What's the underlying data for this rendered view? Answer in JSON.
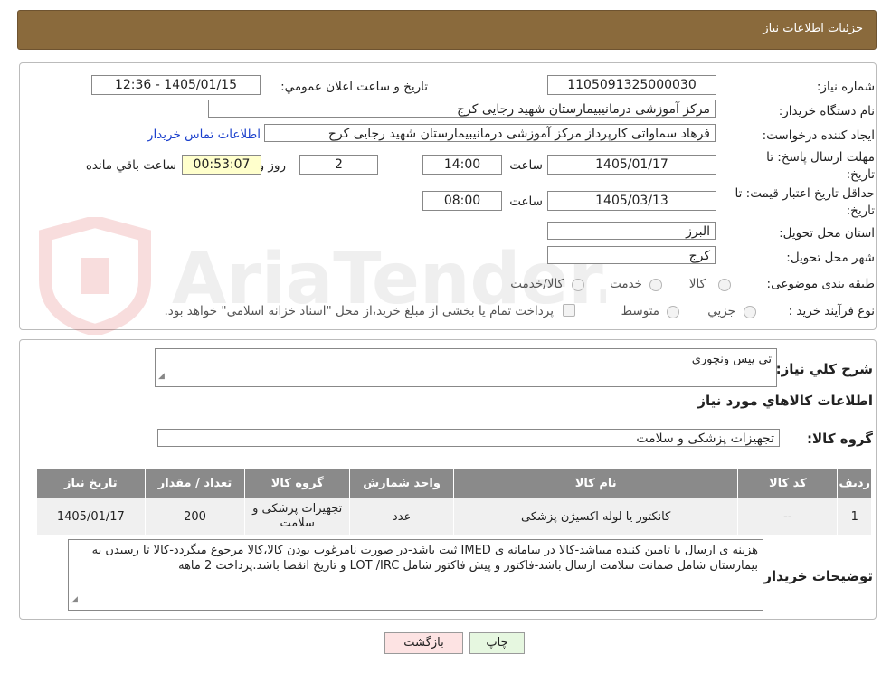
{
  "header": {
    "title": "جزئيات اطلاعات نياز"
  },
  "watermark": {
    "text": "AriaTender.neT"
  },
  "form": {
    "need_number": {
      "label": "شماره نياز:",
      "value": "1105091325000030"
    },
    "announce": {
      "label": "تاريخ و ساعت اعلان عمومي:",
      "value": "1405/01/15 - 12:36"
    },
    "buyer_org": {
      "label": "نام دستگاه خريدار:",
      "value": "مرکز آموزشی درمانیبیمارستان شهید رجایی کرج"
    },
    "requester": {
      "label": "ايجاد کننده درخواست:",
      "value": "فرهاد سماواتی کارپرداز مرکز آموزشی درمانیبیمارستان شهید رجایی کرج",
      "contact_link": "اطلاعات تماس خريدار"
    },
    "reply_deadline": {
      "label": "مهلت ارسال پاسخ: تا تاريخ:",
      "date": "1405/01/17",
      "time_label": "ساعت",
      "time": "14:00",
      "days": "2",
      "days_label": "روز و",
      "remaining": "00:53:07",
      "remaining_label": "ساعت باقي مانده"
    },
    "price_validity": {
      "label": "حداقل تاريخ اعتبار قيمت: تا تاريخ:",
      "date": "1405/03/13",
      "time_label": "ساعت",
      "time": "08:00"
    },
    "province": {
      "label": "استان محل تحويل:",
      "value": "البرز"
    },
    "city": {
      "label": "شهر محل تحويل:",
      "value": "کرج"
    },
    "category": {
      "label": "طبقه بندی موضوعی:",
      "options": [
        "کالا",
        "خدمت",
        "کالا/خدمت"
      ]
    },
    "process": {
      "label": "نوع فرآيند خريد :",
      "options": [
        "جزيي",
        "متوسط"
      ],
      "note": "پرداخت تمام یا بخشی از مبلغ خرید،از محل \"اسناد خزانه اسلامی\" خواهد بود."
    }
  },
  "summary": {
    "label": "شرح کلي نياز:",
    "value": "تی پیس ونچوری",
    "items_title": "اطلاعات کالاهاي مورد نياز",
    "group_label": "گروه کالا:",
    "group_value": "تجهیزات پزشکی و سلامت"
  },
  "table": {
    "headers": [
      "رديف",
      "کد کالا",
      "نام کالا",
      "واحد شمارش",
      "گروه کالا",
      "تعداد / مقدار",
      "تاريخ نياز"
    ],
    "rows": [
      [
        "1",
        "--",
        "کانکتور یا لوله اکسیژن پزشکی",
        "عدد",
        "تجهیزات پزشکی و سلامت",
        "200",
        "1405/01/17"
      ]
    ]
  },
  "buyer_notes": {
    "label": "توضيحات خريدار:",
    "value": "هزینه ی ارسال با تامین کننده میباشد-کالا در سامانه ی IMED ثبت باشد-در صورت نامرغوب بودن کالا،کالا مرجوع میگردد-کالا تا رسیدن به بیمارستان شامل ضمانت سلامت ارسال باشد-فاکتور و پیش فاکتور شامل LOT /IRC و تاریخ انقضا باشد.پرداخت 2 ماهه"
  },
  "buttons": {
    "print": "چاپ",
    "back": "بازگشت"
  },
  "colors": {
    "header_bg": "#8a6a3c",
    "table_header_bg": "#8a8a8a",
    "print_btn": "#e6f7e0",
    "back_btn": "#fde3e3",
    "link": "#1a3fcc"
  }
}
